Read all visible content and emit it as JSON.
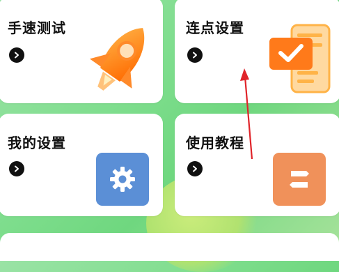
{
  "cards": [
    {
      "title": "手速测试",
      "icon": "rocket-icon"
    },
    {
      "title": "连点设置",
      "icon": "checklist-icon"
    },
    {
      "title": "我的设置",
      "icon": "gear-icon"
    },
    {
      "title": "使用教程",
      "icon": "tutorial-icon"
    }
  ],
  "colors": {
    "background": "#7ddd8c",
    "rocket": "#ff7a1a",
    "checklist": "#ffb347",
    "gear_tile": "#5b8fd6",
    "tutorial_tile": "#f0915a",
    "annotation_arrow": "#e0242a"
  }
}
